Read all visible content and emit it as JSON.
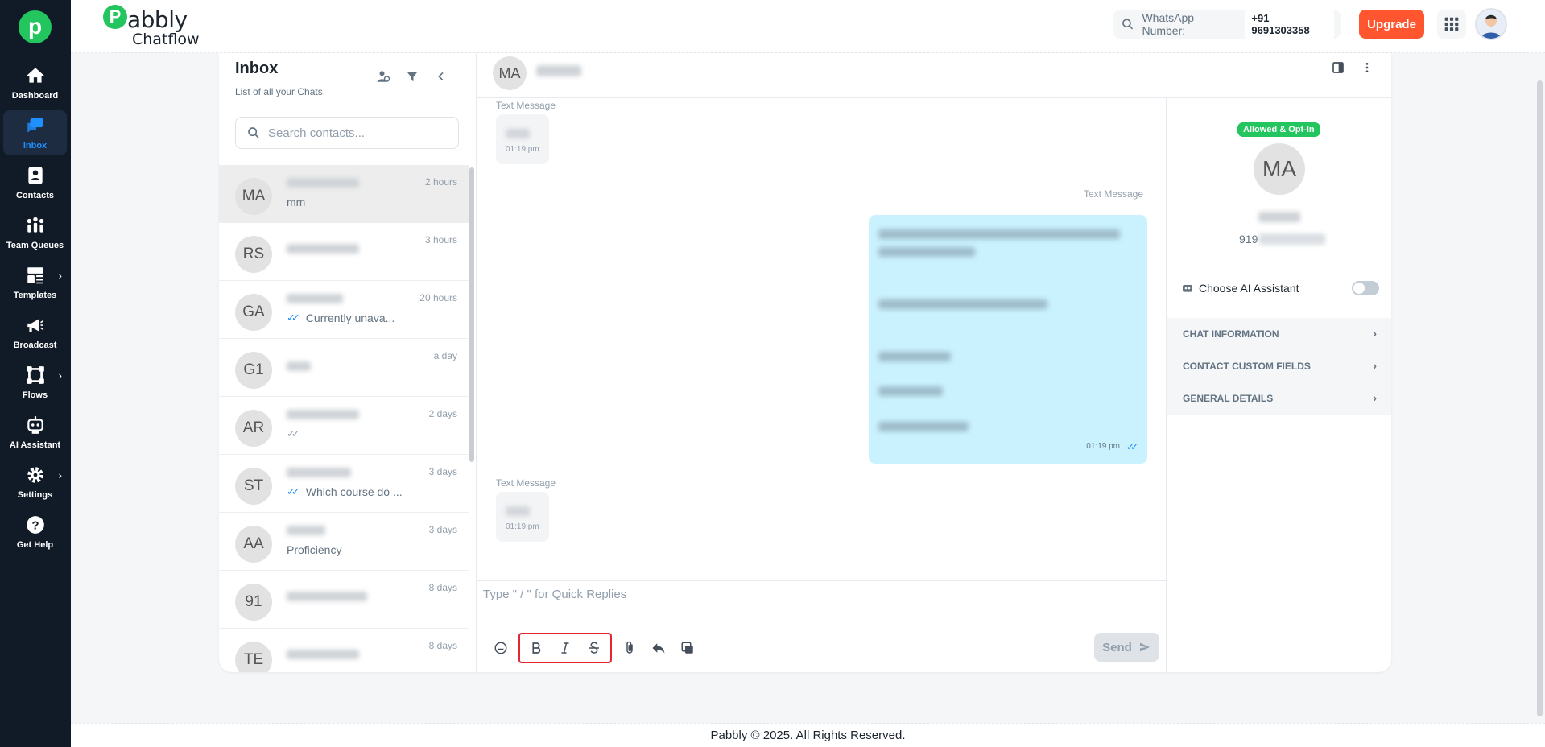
{
  "sidebar": {
    "logo_letter": "p",
    "items": [
      {
        "label": "Dashboard"
      },
      {
        "label": "Inbox"
      },
      {
        "label": "Contacts"
      },
      {
        "label": "Team Queues"
      },
      {
        "label": "Templates"
      },
      {
        "label": "Broadcast"
      },
      {
        "label": "Flows"
      },
      {
        "label": "AI Assistant"
      },
      {
        "label": "Settings"
      },
      {
        "label": "Get Help"
      }
    ],
    "active": "Inbox"
  },
  "header": {
    "brand_letter": "P",
    "brand_line1": "abbly",
    "brand_line2": "Chatflow",
    "whatsapp_label": "WhatsApp Number:",
    "whatsapp_number": "+91 9691303358",
    "upgrade_label": "Upgrade"
  },
  "inbox": {
    "title": "Inbox",
    "subtitle": "List of all your Chats.",
    "search_placeholder": "Search contacts...",
    "chats": [
      {
        "initials": "MA",
        "time": "2 hours",
        "message": "mm",
        "ticks": ""
      },
      {
        "initials": "RS",
        "time": "3 hours",
        "message": "",
        "ticks": ""
      },
      {
        "initials": "GA",
        "time": "20 hours",
        "message": "Currently unava...",
        "ticks": "blue"
      },
      {
        "initials": "G1",
        "time": "a day",
        "message": "",
        "ticks": ""
      },
      {
        "initials": "AR",
        "time": "2 days",
        "message": "",
        "ticks": "grey"
      },
      {
        "initials": "ST",
        "time": "3 days",
        "message": "Which course do ...",
        "ticks": "blue"
      },
      {
        "initials": "AA",
        "time": "3 days",
        "message": "Proficiency",
        "ticks": ""
      },
      {
        "initials": "91",
        "time": "8 days",
        "message": "",
        "ticks": ""
      },
      {
        "initials": "TE",
        "time": "8 days",
        "message": "",
        "ticks": ""
      }
    ]
  },
  "chat": {
    "contact_initials": "MA",
    "messages": [
      {
        "label": "Text Message",
        "direction": "in",
        "time": "01:19 pm"
      },
      {
        "label": "Text Message",
        "direction": "out",
        "time": "01:19 pm"
      },
      {
        "label": "Text Message",
        "direction": "in",
        "time": "01:19 pm"
      }
    ],
    "composer_placeholder": "Type \" / \" for Quick Replies",
    "send_label": "Send"
  },
  "contact_panel": {
    "status_badge": "Allowed & Opt-In",
    "initials": "MA",
    "phone_prefix": "919",
    "ai_label": "Choose AI Assistant",
    "sections": [
      "CHAT INFORMATION",
      "CONTACT CUSTOM FIELDS",
      "GENERAL DETAILS"
    ]
  },
  "footer": {
    "text": "Pabbly © 2025. All Rights Reserved."
  },
  "colors": {
    "sidebar_bg": "#111b27",
    "accent_green": "#22c55e",
    "upgrade_orange": "#ff5630",
    "active_blue": "#1e90ff",
    "outgoing_bubble": "#caf2fe",
    "highlight_red": "#e5262f"
  }
}
